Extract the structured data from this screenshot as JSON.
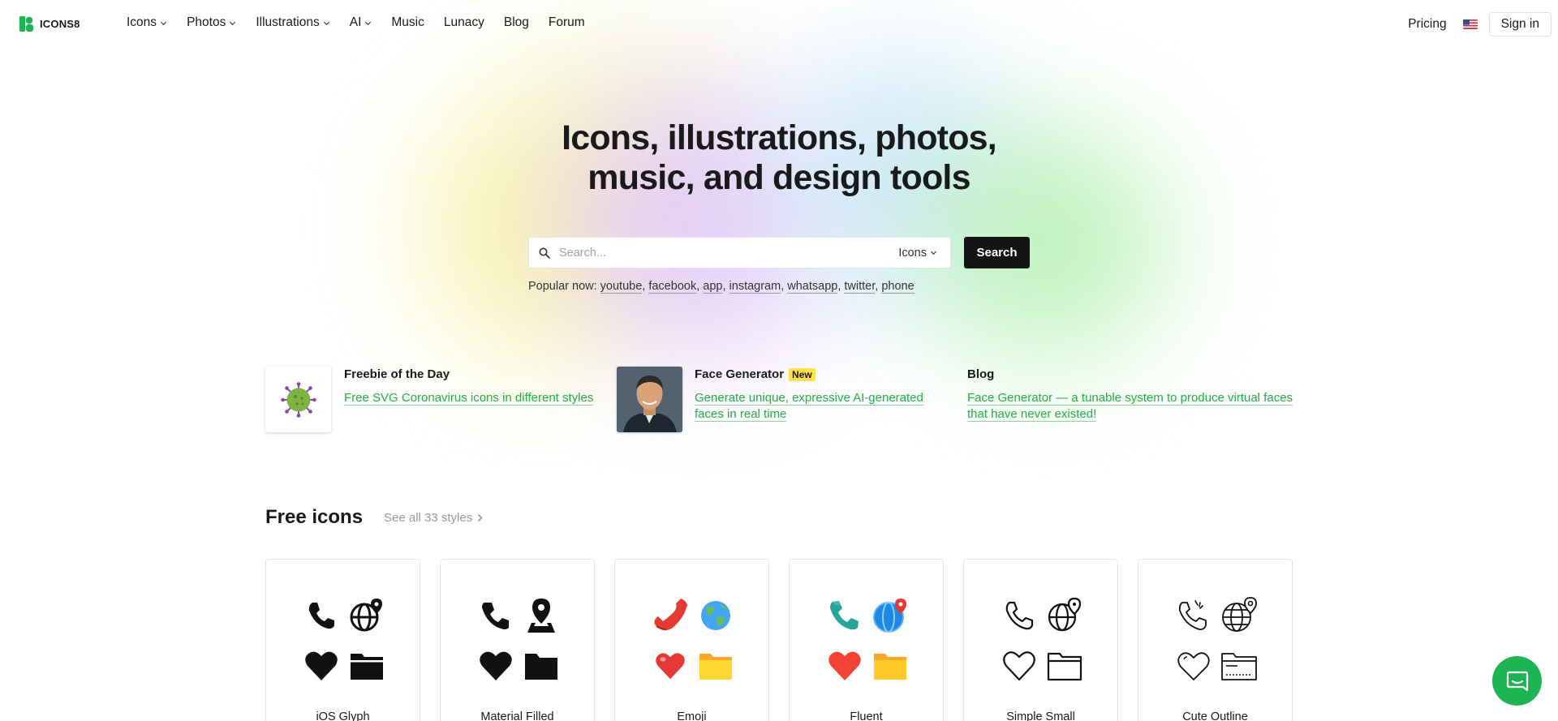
{
  "brand": {
    "name": "ICONS8",
    "accent": "#1db454"
  },
  "nav": {
    "items": [
      {
        "label": "Icons",
        "dropdown": true
      },
      {
        "label": "Photos",
        "dropdown": true
      },
      {
        "label": "Illustrations",
        "dropdown": true
      },
      {
        "label": "AI",
        "dropdown": true
      },
      {
        "label": "Music",
        "dropdown": false
      },
      {
        "label": "Lunacy",
        "dropdown": false
      },
      {
        "label": "Blog",
        "dropdown": false
      },
      {
        "label": "Forum",
        "dropdown": false
      }
    ],
    "pricing": "Pricing",
    "signin": "Sign in"
  },
  "hero": {
    "title_line1": "Icons, illustrations, photos,",
    "title_line2": "music, and design tools"
  },
  "search": {
    "placeholder": "Search...",
    "type": "Icons",
    "button": "Search",
    "popular_label": "Popular now:",
    "popular": [
      "youtube",
      "facebook",
      "app",
      "instagram",
      "whatsapp",
      "twitter",
      "phone"
    ]
  },
  "features": {
    "freebie": {
      "title": "Freebie of the Day",
      "link": "Free SVG Coronavirus icons in different styles"
    },
    "face": {
      "title": "Face Generator",
      "badge": "New",
      "link_line1": "Generate unique, expressive AI-generated",
      "link_line2": "faces in real time"
    },
    "blog": {
      "title": "Blog",
      "link_line1": "Face Generator — a tunable system to produce virtual faces",
      "link_line2": "that have never existed!"
    }
  },
  "free_icons": {
    "title": "Free icons",
    "see_all": "See all 33 styles",
    "styles": [
      {
        "label": "iOS Glyph"
      },
      {
        "label": "Material Filled"
      },
      {
        "label": "Emoji"
      },
      {
        "label": "Fluent"
      },
      {
        "label": "Simple Small"
      },
      {
        "label": "Cute Outline"
      }
    ]
  }
}
